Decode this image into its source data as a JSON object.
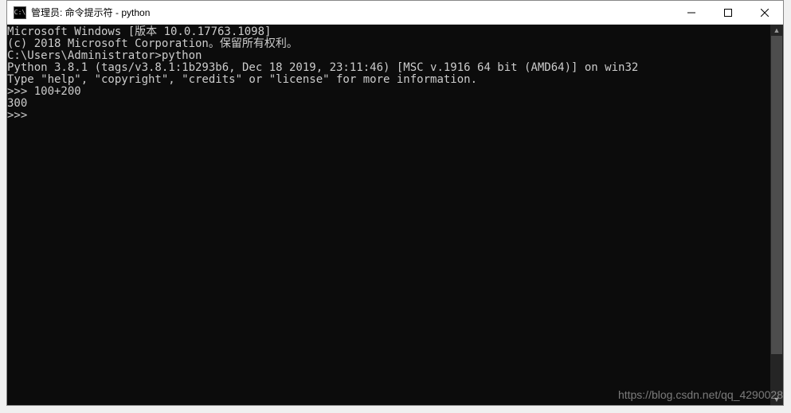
{
  "titlebar": {
    "icon_label": "C:\\",
    "title": "管理员: 命令提示符 - python"
  },
  "terminal": {
    "lines": [
      "Microsoft Windows [版本 10.0.17763.1098]",
      "(c) 2018 Microsoft Corporation。保留所有权利。",
      "",
      "C:\\Users\\Administrator>python",
      "Python 3.8.1 (tags/v3.8.1:1b293b6, Dec 18 2019, 23:11:46) [MSC v.1916 64 bit (AMD64)] on win32",
      "Type \"help\", \"copyright\", \"credits\" or \"license\" for more information.",
      ">>> 100+200",
      "300",
      ">>>"
    ]
  },
  "watermark": "https://blog.csdn.net/qq_4290028"
}
